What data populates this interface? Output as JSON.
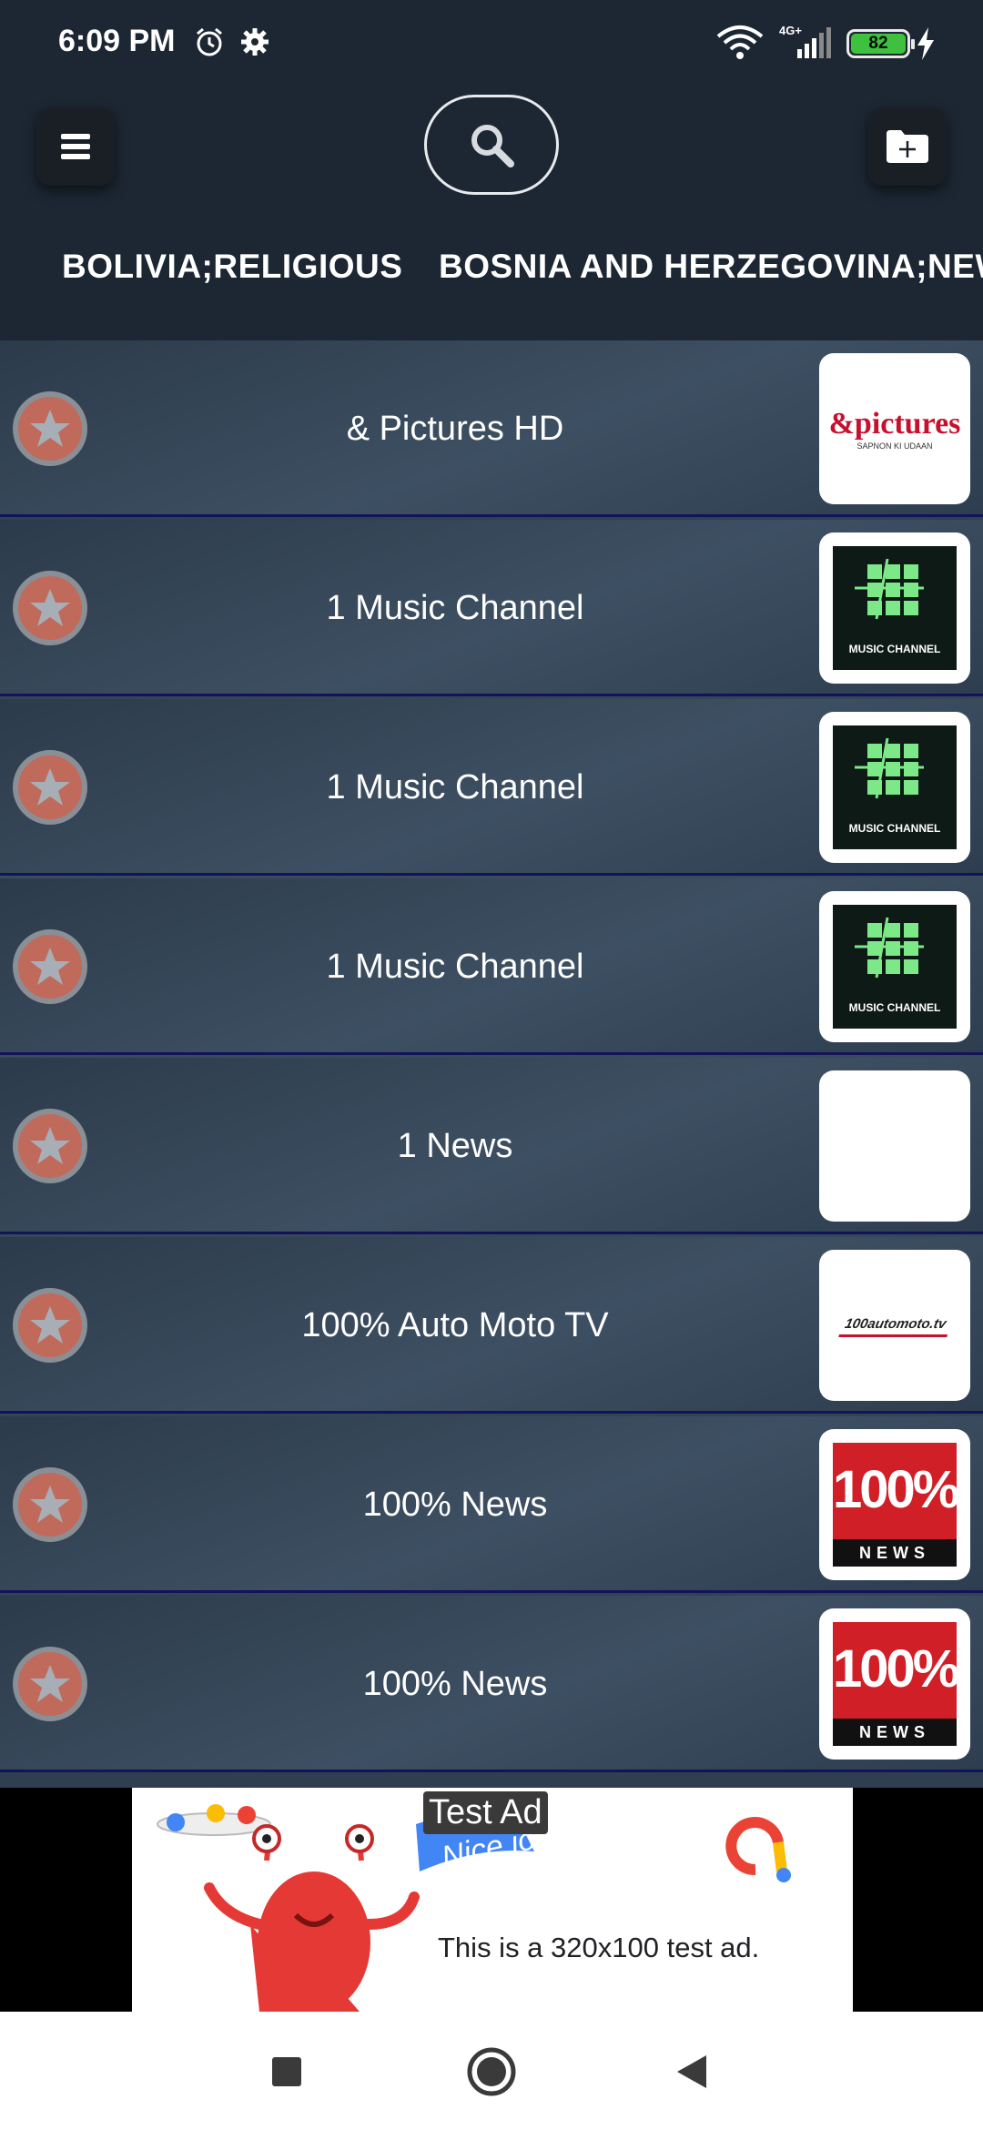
{
  "status_bar": {
    "time": "6:09 PM",
    "network": "4G+",
    "battery_level": "82",
    "icons": [
      "alarm-icon",
      "gear-icon",
      "wifi-icon",
      "signal-icon",
      "battery-icon",
      "charging-bolt-icon"
    ]
  },
  "header": {
    "menu_icon": "hamburger-menu-icon",
    "search_icon": "search-icon",
    "add_folder_icon": "folder-add-icon",
    "tabs": [
      {
        "label": "BOLIVIA;RELIGIOUS"
      },
      {
        "label": "BOSNIA AND HERZEGOVINA;NEWS"
      }
    ]
  },
  "channels": [
    {
      "name": "& Pictures HD",
      "logo": "andpictures",
      "logo_text": "&pictures",
      "logo_subtext": "SAPNON KI UDAAN"
    },
    {
      "name": "1 Music Channel",
      "logo": "music",
      "logo_text": "MUSIC CHANNEL"
    },
    {
      "name": "1 Music Channel",
      "logo": "music",
      "logo_text": "MUSIC CHANNEL"
    },
    {
      "name": "1 Music Channel",
      "logo": "music",
      "logo_text": "MUSIC CHANNEL"
    },
    {
      "name": "1 News",
      "logo": "blank"
    },
    {
      "name": "100% Auto Moto TV",
      "logo": "automoto",
      "logo_text": "100automoto.tv"
    },
    {
      "name": "100% News",
      "logo": "news100",
      "logo_text": "100%",
      "logo_subtext": "NEWS"
    },
    {
      "name": "100% News",
      "logo": "news100",
      "logo_text": "100%",
      "logo_subtext": "NEWS"
    }
  ],
  "ad": {
    "badge": "Test Ad",
    "banner_text": "Nice job!",
    "description": "This is a 320x100 test ad."
  },
  "nav": {
    "icons": [
      "recents-square-icon",
      "home-circle-icon",
      "back-triangle-icon"
    ]
  },
  "colors": {
    "header_bg": "#1c2733",
    "row_separator": "#13135a",
    "star_fill": "#c06a5c",
    "music_logo_green": "#6ee07a",
    "news_logo_red": "#d01f26"
  }
}
